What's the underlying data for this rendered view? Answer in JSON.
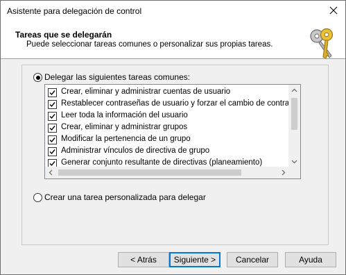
{
  "window": {
    "title": "Asistente para delegación de control"
  },
  "header": {
    "title": "Tareas que se delegarán",
    "subtitle": "Puede seleccionar tareas comunes o personalizar sus propias tareas.",
    "icon": "keys-icon"
  },
  "options": {
    "common_label": "Delegar las siguientes tareas comunes:",
    "common_selected": true,
    "custom_label": "Crear una tarea personalizada para delegar",
    "custom_selected": false
  },
  "tasks": [
    {
      "label": "Crear, eliminar y administrar cuentas de usuario",
      "checked": true
    },
    {
      "label": "Restablecer contraseñas de usuario y forzar el cambio de contraseña",
      "checked": true
    },
    {
      "label": "Leer toda la información del usuario",
      "checked": true
    },
    {
      "label": "Crear, eliminar y administrar grupos",
      "checked": true
    },
    {
      "label": "Modificar la pertenencia de un grupo",
      "checked": true
    },
    {
      "label": "Administrar vínculos de directiva de grupo",
      "checked": true
    },
    {
      "label": "Generar conjunto resultante de directivas (planeamiento)",
      "checked": true
    }
  ],
  "buttons": {
    "back": "< Atrás",
    "next": "Siguiente >",
    "cancel": "Cancelar",
    "help": "Ayuda"
  }
}
